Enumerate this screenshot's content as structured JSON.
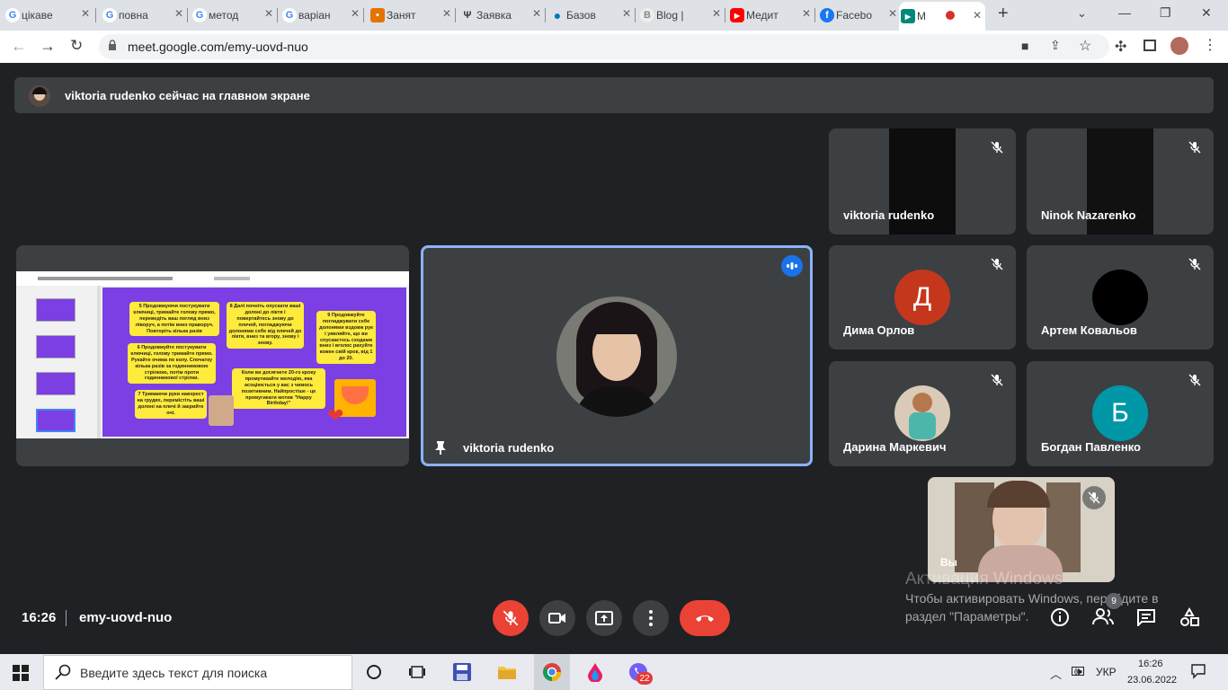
{
  "browser": {
    "tabs": [
      {
        "label": "цікаве",
        "icon": "google-icon",
        "color": "#4285f4"
      },
      {
        "label": "повна",
        "icon": "google-icon",
        "color": "#4285f4"
      },
      {
        "label": "метод",
        "icon": "google-icon",
        "color": "#4285f4"
      },
      {
        "label": "варіан",
        "icon": "google-icon",
        "color": "#4285f4"
      },
      {
        "label": "Занят",
        "icon": "classroom-icon",
        "color": "#e37400"
      },
      {
        "label": "Заявка",
        "icon": "trident-icon",
        "color": "#333333"
      },
      {
        "label": "Базов",
        "icon": "drop-icon",
        "color": "#0277bd"
      },
      {
        "label": "Blog |",
        "icon": "blog-icon",
        "color": "#9e9e9e"
      },
      {
        "label": "Медит",
        "icon": "youtube-icon",
        "color": "#ff0000"
      },
      {
        "label": "Facebo",
        "icon": "facebook-icon",
        "color": "#1877f2"
      },
      {
        "label": "М",
        "icon": "meet-icon",
        "color": "#00897b"
      }
    ],
    "url": "meet.google.com/emy-uovd-nuo"
  },
  "banner": {
    "text": "viktoria rudenko сейчас на главном экране"
  },
  "slide": {
    "notes": [
      "5  Продовжуючи постукувати ключиці, тримайте голову прямо, переведіть ваш погляд вниз ліворуч, а потім вниз праворуч. Повторіть кілька разів",
      "6  Продовжуйте постукувати ключиці, голову тримайте прямо. Рукайте очима по колу. Спочатку кілька разів за годинниковою стрілкою, потім проти годинникової стрілки.",
      "7  Тримаючи руки навхрест на грудях, перемістіть ваші долоні на плечі й закрийте очі.",
      "8  Далі почніть опускати ваші долоні до ліктя і повертайтесь знову до плечей, погладжуючи долонями себе від плечей до ліктя, вниз та вгору, знову і знову.",
      "Коли ви досягнете 20-го кроку промугикайте мелодію, яка асоціюється у вас з чимось позитивним. Найпростіше - це промугикати мотив \"Happy Birthday!\"",
      "9  Продовжуйте погладжувати себе долонями вздовж рук і уявляйте, що ви спускаєтесь сходами вниз і вголос рахуйте кожен свій крок, від 1 до 20."
    ]
  },
  "participants": [
    {
      "name": "viktoria rudenko",
      "type": "video"
    },
    {
      "name": "Ninok Nazarenko",
      "type": "video"
    },
    {
      "name": "Дима Орлов",
      "initial": "Д",
      "color": "#c5371d"
    },
    {
      "name": "Артем Ковальов",
      "initial": "",
      "color": "#000000"
    },
    {
      "name": "Дарина Маркевич",
      "type": "photo"
    },
    {
      "name": "Богдан Павленко",
      "initial": "Б",
      "color": "#0097a7"
    }
  ],
  "main_speaker": {
    "name": "viktoria rudenko"
  },
  "self_view": {
    "label": "Вы"
  },
  "meeting": {
    "time": "16:26",
    "code": "emy-uovd-nuo"
  },
  "watermark": {
    "title": "Активация Windows",
    "line1": "Чтобы активировать Windows, перейдите в",
    "line2": "раздел \"Параметры\"."
  },
  "people_badge": "9",
  "taskbar": {
    "search_placeholder": "Введите здесь текст для поиска",
    "viber_badge": "22",
    "lang": "УКР",
    "time": "16:26",
    "date": "23.06.2022"
  },
  "colors": {
    "accent": "#8ab4f8",
    "end_call": "#ea4335",
    "bg": "#202124",
    "tile": "#3c4043"
  }
}
